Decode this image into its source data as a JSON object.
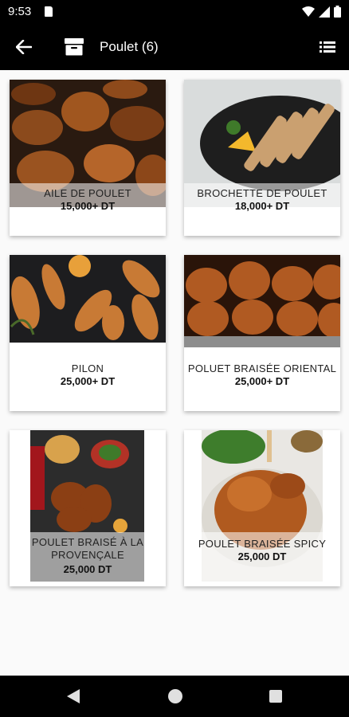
{
  "status": {
    "time": "9:53"
  },
  "header": {
    "title": "Poulet (6)"
  },
  "products": [
    {
      "name": "AILE DE POULET",
      "price": "15,000+ DT"
    },
    {
      "name": "BROCHETTE DE POULET",
      "price": "18,000+ DT"
    },
    {
      "name": "PILON",
      "price": "25,000+ DT"
    },
    {
      "name": "POLUET BRAISÉE ORIENTAL",
      "price": "25,000+ DT"
    },
    {
      "name": "POULET BRAISÉ À LA PROVENÇALE",
      "price": "25,000 DT"
    },
    {
      "name": "POULET BRAISÉE SPICY",
      "price": "25,000 DT"
    }
  ],
  "colors": {
    "bar": "#000000",
    "background": "#fafafa",
    "card": "#ffffff"
  },
  "icons": [
    "sd-card-icon",
    "wifi-icon",
    "signal-icon",
    "battery-icon",
    "back-arrow-icon",
    "box-icon",
    "list-view-icon",
    "nav-back-icon",
    "nav-home-icon",
    "nav-recent-icon"
  ]
}
